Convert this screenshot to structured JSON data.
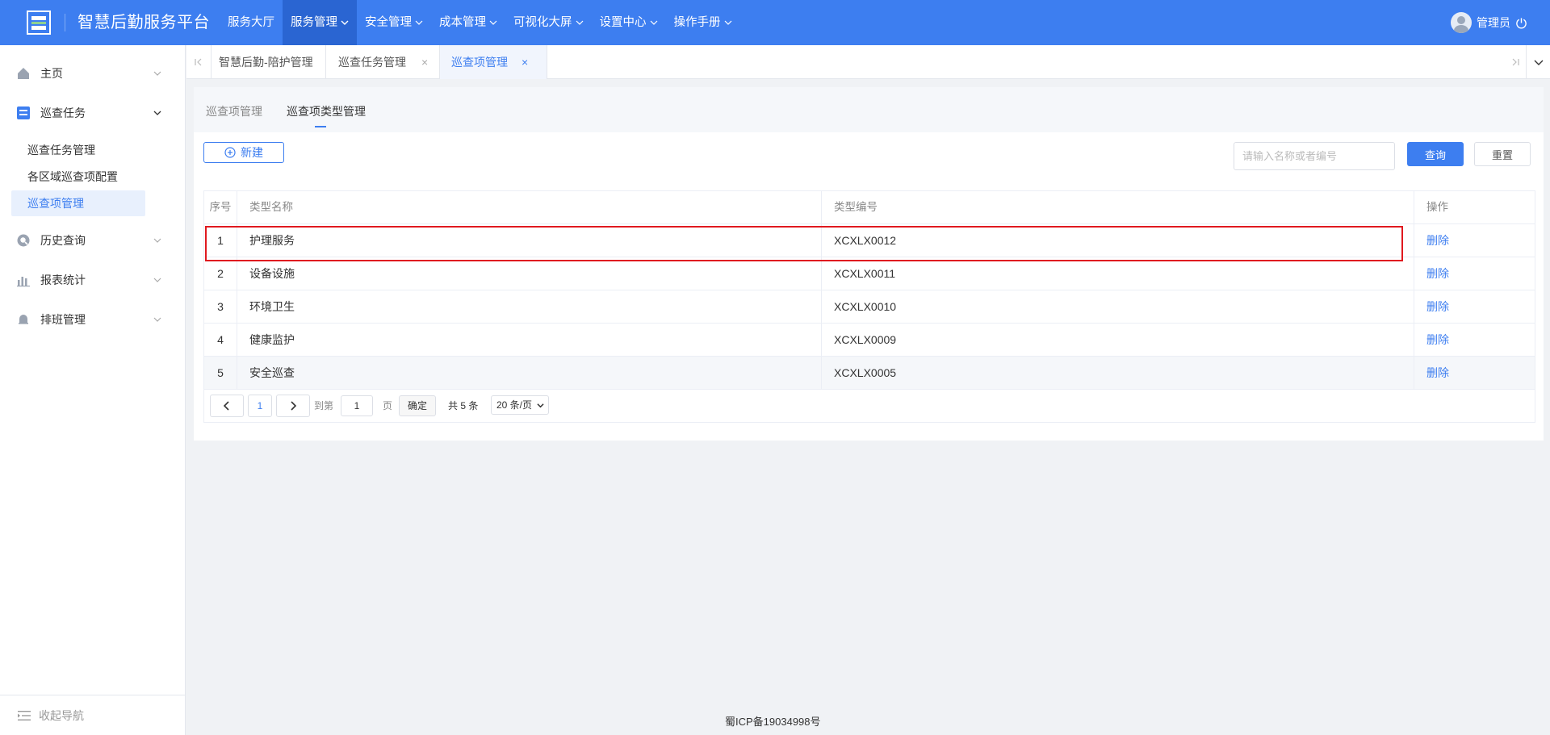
{
  "header": {
    "app_title": "智慧后勤服务平台",
    "nav": [
      {
        "label": "服务大厅",
        "has_menu": false,
        "active": false
      },
      {
        "label": "服务管理",
        "has_menu": true,
        "active": true
      },
      {
        "label": "安全管理",
        "has_menu": true,
        "active": false
      },
      {
        "label": "成本管理",
        "has_menu": true,
        "active": false
      },
      {
        "label": "可视化大屏",
        "has_menu": true,
        "active": false
      },
      {
        "label": "设置中心",
        "has_menu": true,
        "active": false
      },
      {
        "label": "操作手册",
        "has_menu": true,
        "active": false
      }
    ],
    "user_name": "管理员"
  },
  "sidebar": {
    "groups": [
      {
        "label": "主页",
        "icon": "home-icon"
      },
      {
        "label": "巡查任务",
        "icon": "task-icon",
        "expanded": true,
        "items": [
          "巡查任务管理",
          "各区域巡查项配置",
          "巡查项管理"
        ],
        "active_item": "巡查项管理"
      },
      {
        "label": "历史查询",
        "icon": "history-icon"
      },
      {
        "label": "报表统计",
        "icon": "chart-icon"
      },
      {
        "label": "排班管理",
        "icon": "bell-icon"
      }
    ],
    "collapse_label": "收起导航"
  },
  "tabs": [
    {
      "label": "智慧后勤-陪护管理",
      "closable": false,
      "active": false
    },
    {
      "label": "巡查任务管理",
      "closable": true,
      "active": false
    },
    {
      "label": "巡查项管理",
      "closable": true,
      "active": true
    }
  ],
  "subtabs": [
    {
      "label": "巡查项管理",
      "active": false
    },
    {
      "label": "巡查项类型管理",
      "active": true
    }
  ],
  "toolbar": {
    "new_label": "新建",
    "search_placeholder": "请输入名称或者编号",
    "search_value": "",
    "query_label": "查询",
    "reset_label": "重置"
  },
  "table": {
    "columns": [
      "序号",
      "类型名称",
      "类型编号",
      "操作"
    ],
    "rows": [
      {
        "idx": "1",
        "name": "护理服务",
        "code": "XCXLX0012",
        "action": "删除"
      },
      {
        "idx": "2",
        "name": "设备设施",
        "code": "XCXLX0011",
        "action": "删除"
      },
      {
        "idx": "3",
        "name": "环境卫生",
        "code": "XCXLX0010",
        "action": "删除"
      },
      {
        "idx": "4",
        "name": "健康监护",
        "code": "XCXLX0009",
        "action": "删除"
      },
      {
        "idx": "5",
        "name": "安全巡查",
        "code": "XCXLX0005",
        "action": "删除"
      }
    ],
    "highlighted_row": 1
  },
  "pagination": {
    "current_page": "1",
    "goto_label": "到第",
    "goto_value": "1",
    "page_unit": "页",
    "confirm_label": "确定",
    "total_text": "共 5 条",
    "page_size": "20 条/页"
  },
  "footer": {
    "icp": "蜀ICP备19034998号"
  },
  "colors": {
    "primary": "#3d7ef0",
    "header_active": "#2a65d2",
    "highlight": "#e0191f"
  }
}
